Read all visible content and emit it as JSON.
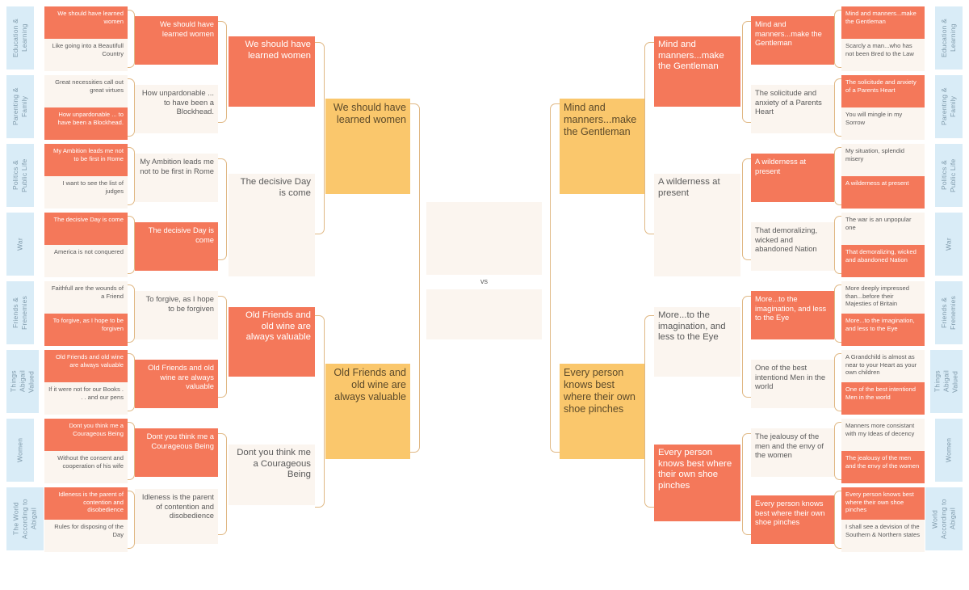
{
  "theme": {
    "winner_color": "#f4785a",
    "loser_color": "#fbf5ef",
    "champion_color": "#fac76c",
    "category_color": "#d9ecf7",
    "connector_color": "#e0b884",
    "background": "#ffffff"
  },
  "center": {
    "vs_label": "vs"
  },
  "categories_left": [
    {
      "label": "Education &\nLearning"
    },
    {
      "label": "Parenting &\nFamily"
    },
    {
      "label": "Politics &\nPublic Life"
    },
    {
      "label": "War"
    },
    {
      "label": "Friends &\nFrenemies"
    },
    {
      "label": "Things\nAbigail\nValued"
    },
    {
      "label": "Women"
    },
    {
      "label": "The World\nAccording to\nAbigail"
    }
  ],
  "categories_right": [
    {
      "label": "Education &\nLearning"
    },
    {
      "label": "Parenting &\nFamily"
    },
    {
      "label": "Politics &\nPublic Life"
    },
    {
      "label": "War"
    },
    {
      "label": "Friends &\nFrenemies"
    },
    {
      "label": "Things\nAbigail\nValued"
    },
    {
      "label": "Women"
    },
    {
      "label": "World\nAccording to\nAbigail"
    }
  ],
  "left": {
    "round1": [
      {
        "label": "We should have learned women",
        "state": "win"
      },
      {
        "label": "Like going into a Beautifull Country",
        "state": "lose"
      },
      {
        "label": "Great necessities call out great virtues",
        "state": "lose"
      },
      {
        "label": "How unpardonable ... to have been a Blockhead.",
        "state": "win"
      },
      {
        "label": "My Ambition leads me not to be first in Rome",
        "state": "win"
      },
      {
        "label": "I want to see the list of judges",
        "state": "lose"
      },
      {
        "label": "The decisive Day is come",
        "state": "win"
      },
      {
        "label": "America is not conquered",
        "state": "lose"
      },
      {
        "label": "Faithfull are the wounds of a Friend",
        "state": "lose"
      },
      {
        "label": "To forgive, as I hope to be forgiven",
        "state": "win"
      },
      {
        "label": "Old Friends and old wine are always valuable",
        "state": "win"
      },
      {
        "label": "If it were not for our Books . . . and our pens",
        "state": "lose"
      },
      {
        "label": "Dont you think me a Courageous Being",
        "state": "win"
      },
      {
        "label": "Without the consent and cooperation of his wife",
        "state": "lose"
      },
      {
        "label": "Idleness is the parent of contention and disobedience",
        "state": "win"
      },
      {
        "label": "Rules for disposing of the Day",
        "state": "lose"
      }
    ],
    "round2": [
      {
        "label": "We should have learned women",
        "state": "win"
      },
      {
        "label": "How unpardonable ... to have been a Blockhead.",
        "state": "lose"
      },
      {
        "label": "My Ambition leads me not to be first in Rome",
        "state": "lose"
      },
      {
        "label": "The decisive Day is come",
        "state": "win"
      },
      {
        "label": "To forgive, as I hope to be forgiven",
        "state": "lose"
      },
      {
        "label": "Old Friends and old wine are always valuable",
        "state": "win"
      },
      {
        "label": "Dont you think me a Courageous Being",
        "state": "win"
      },
      {
        "label": "Idleness is the parent of contention and disobedience",
        "state": "lose"
      }
    ],
    "round3": [
      {
        "label": "We should have learned women",
        "state": "win"
      },
      {
        "label": "The decisive Day is come",
        "state": "lose"
      },
      {
        "label": "Old Friends and old wine are always valuable",
        "state": "win"
      },
      {
        "label": "Dont you think me a Courageous Being",
        "state": "lose"
      }
    ],
    "round4": [
      {
        "label": "We should have learned women",
        "state": "champ"
      },
      {
        "label": "Old Friends and old wine are always valuable",
        "state": "champ"
      }
    ]
  },
  "right": {
    "round1": [
      {
        "label": "Mind and manners...make the Gentleman",
        "state": "win"
      },
      {
        "label": "Scarcly a man...who has not been Bred to the Law",
        "state": "lose"
      },
      {
        "label": "The solicitude and anxiety of a Parents Heart",
        "state": "win"
      },
      {
        "label": "You will mingle in my Sorrow",
        "state": "lose"
      },
      {
        "label": "My situation, splendid misery",
        "state": "lose"
      },
      {
        "label": "A wilderness at present",
        "state": "win"
      },
      {
        "label": "The war is an unpopular one",
        "state": "lose"
      },
      {
        "label": "That demoralizing, wicked and abandoned Nation",
        "state": "win"
      },
      {
        "label": "More deeply impressed than...before their Majesties of Britain",
        "state": "lose"
      },
      {
        "label": "More...to the imagination, and less to the Eye",
        "state": "win"
      },
      {
        "label": "A Grandchild is almost as near to your Heart as your own children",
        "state": "lose"
      },
      {
        "label": "One of the best intentiond Men in the world",
        "state": "win"
      },
      {
        "label": "Manners more consistant with my Ideas of decency",
        "state": "lose"
      },
      {
        "label": "The jealousy of the men and the envy of the women",
        "state": "win"
      },
      {
        "label": "Every person knows best where their own shoe pinches",
        "state": "win"
      },
      {
        "label": "I shall see a devision of the Southern & Northern states",
        "state": "lose"
      }
    ],
    "round2": [
      {
        "label": "Mind and manners...make the Gentleman",
        "state": "win"
      },
      {
        "label": "The solicitude and anxiety of a Parents Heart",
        "state": "lose"
      },
      {
        "label": "A wilderness at present",
        "state": "win"
      },
      {
        "label": "That demoralizing, wicked and abandoned Nation",
        "state": "lose"
      },
      {
        "label": "More...to the imagination, and less to the Eye",
        "state": "win"
      },
      {
        "label": "One of the best intentiond Men in the world",
        "state": "lose"
      },
      {
        "label": "The jealousy of the men and the envy of the women",
        "state": "lose"
      },
      {
        "label": "Every person knows best where their own shoe pinches",
        "state": "win"
      }
    ],
    "round3": [
      {
        "label": "Mind and manners...make the Gentleman",
        "state": "win"
      },
      {
        "label": "A wilderness at present",
        "state": "lose"
      },
      {
        "label": "More...to the imagination, and less to the Eye",
        "state": "lose"
      },
      {
        "label": "Every person knows best where their own shoe pinches",
        "state": "win"
      }
    ],
    "round4": [
      {
        "label": "Mind and manners...make the Gentleman",
        "state": "champ"
      },
      {
        "label": "Every person knows best where their own shoe pinches",
        "state": "champ"
      }
    ]
  },
  "final": {
    "slots": [
      {
        "label": "",
        "state": "lose"
      },
      {
        "label": "",
        "state": "lose"
      }
    ]
  }
}
